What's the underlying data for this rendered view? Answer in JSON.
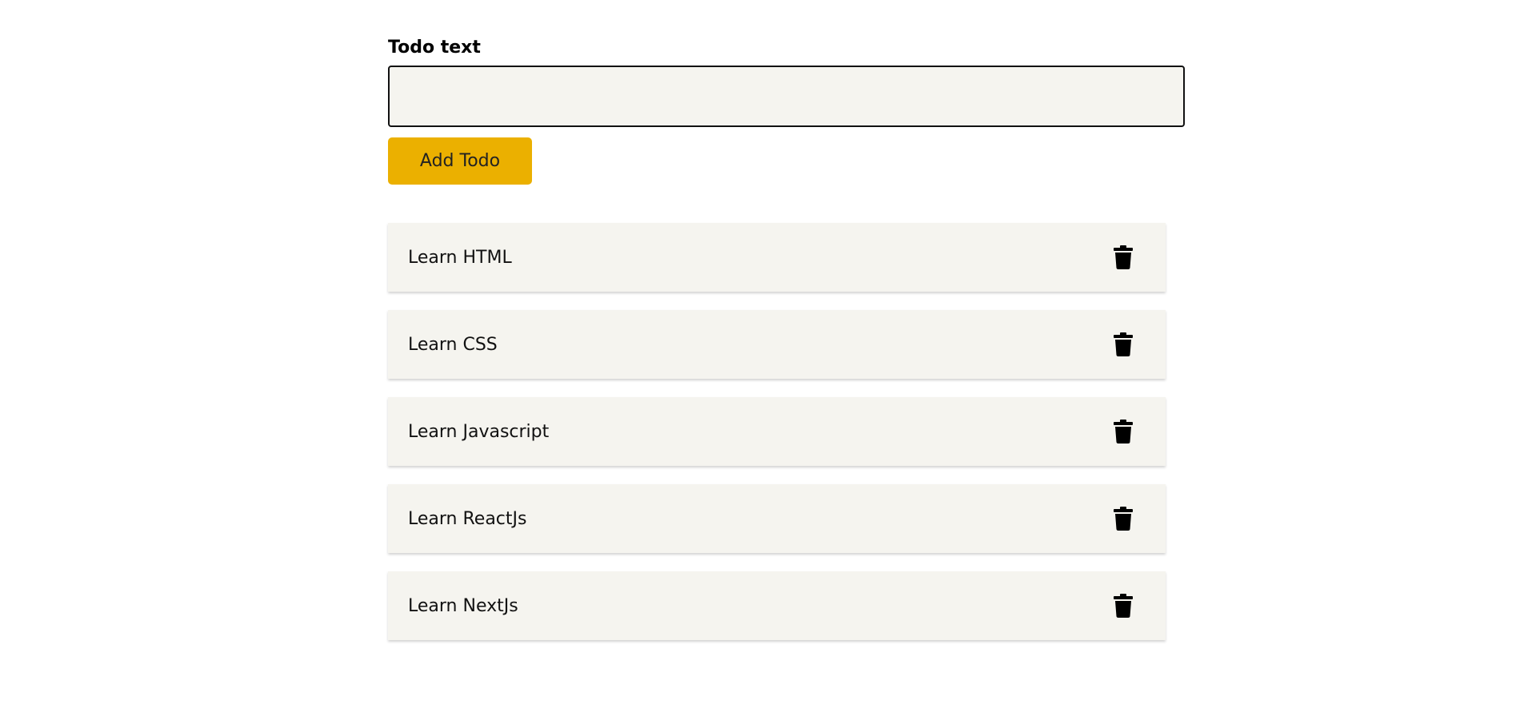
{
  "form": {
    "label": "Todo text",
    "input_value": "",
    "input_placeholder": "",
    "add_button_label": "Add Todo"
  },
  "todos": [
    {
      "text": "Learn HTML",
      "delete_icon": "trash-icon"
    },
    {
      "text": "Learn CSS",
      "delete_icon": "trash-icon"
    },
    {
      "text": "Learn Javascript",
      "delete_icon": "trash-icon"
    },
    {
      "text": "Learn ReactJs",
      "delete_icon": "trash-icon"
    },
    {
      "text": "Learn NextJs",
      "delete_icon": "trash-icon"
    }
  ],
  "colors": {
    "accent_button": "#ebb000",
    "input_background": "#f5f4ef",
    "item_background": "#f5f4ef"
  }
}
